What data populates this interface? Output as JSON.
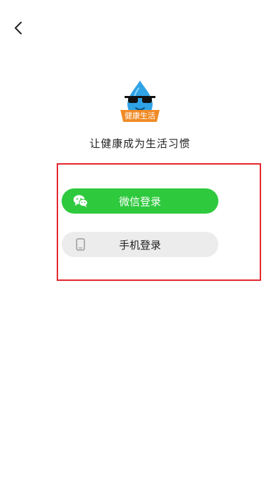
{
  "header": {
    "back_icon": "chevron-left-icon"
  },
  "logo": {
    "badge_text": "健康生活"
  },
  "slogan": "让健康成为生活习惯",
  "login": {
    "wechat_label": "微信登录",
    "wechat_icon": "wechat-icon",
    "phone_label": "手机登录",
    "phone_icon": "phone-icon"
  },
  "colors": {
    "wechat_green": "#2fc93e",
    "phone_gray": "#ececec",
    "highlight_red": "#e3272d",
    "logo_blue": "#2fa3e6",
    "logo_orange": "#f08a24"
  }
}
